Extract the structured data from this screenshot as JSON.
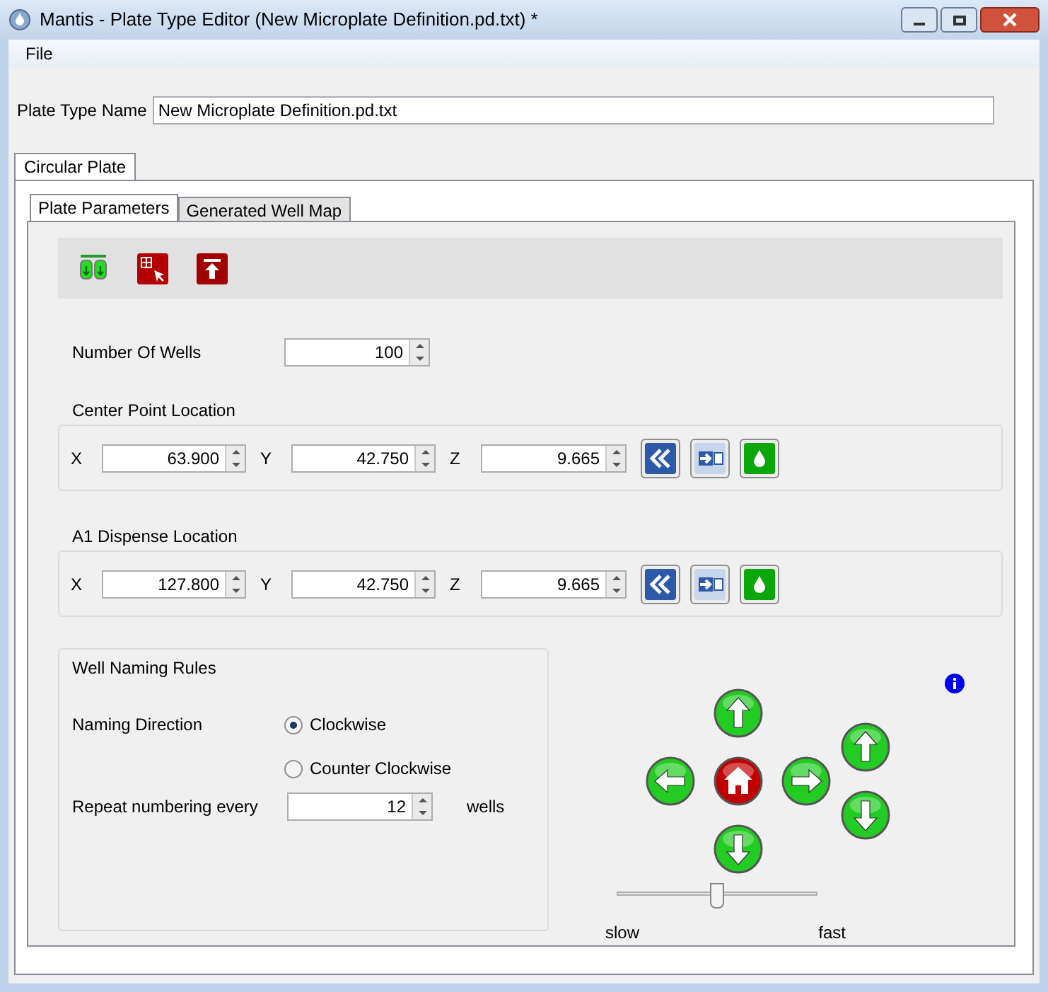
{
  "window": {
    "title": "Mantis - Plate Type Editor (New Microplate Definition.pd.txt) *"
  },
  "menu": [
    "File"
  ],
  "plate_type_name": {
    "label": "Plate Type Name",
    "value": "New Microplate Definition.pd.txt"
  },
  "outer_tabs": [
    {
      "label": "Circular Plate",
      "selected": true
    }
  ],
  "inner_tabs": [
    {
      "label": "Plate Parameters",
      "selected": true
    },
    {
      "label": "Generated Well Map",
      "selected": false
    }
  ],
  "number_of_wells": {
    "label": "Number Of Wells",
    "value": "100"
  },
  "locations": [
    {
      "title": "Center Point Location",
      "fields": [
        {
          "label": "X",
          "value": "63.900"
        },
        {
          "label": "Y",
          "value": "42.750"
        },
        {
          "label": "Z",
          "value": "9.665"
        }
      ]
    },
    {
      "title": "A1 Dispense Location",
      "fields": [
        {
          "label": "X",
          "value": "127.800"
        },
        {
          "label": "Y",
          "value": "42.750"
        },
        {
          "label": "Z",
          "value": "9.665"
        }
      ]
    }
  ],
  "naming": {
    "title": "Well Naming Rules",
    "direction_label": "Naming Direction",
    "options": [
      {
        "label": "Clockwise",
        "selected": true
      },
      {
        "label": "Counter Clockwise",
        "selected": false
      }
    ],
    "repeat_label": "Repeat numbering every",
    "repeat_value": "12",
    "repeat_unit": "wells"
  },
  "speed": {
    "level": 0.5,
    "min_label": "slow",
    "max_label": "fast"
  }
}
